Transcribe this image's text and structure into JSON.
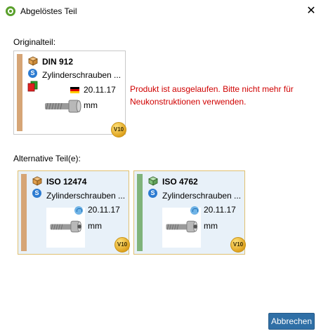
{
  "window": {
    "title": "Abgelöstes Teil",
    "close_glyph": "✕"
  },
  "original_label": "Originalteil:",
  "alternatives_label": "Alternative Teil(e):",
  "original_part": {
    "name": "DIN 912",
    "description": "Zylinderschrauben ...",
    "date": "20.11.17",
    "unit": "mm",
    "version": "V10",
    "stripe_color": "#d6a576",
    "cube_color": "#e0a050",
    "icons": [
      "package-icon",
      "standard-icon",
      "documents-icon",
      "german-flag-icon",
      "version-badge-icon"
    ]
  },
  "message": "Produkt ist ausgelaufen. Bitte nicht mehr für Neukonstruktionen verwenden.",
  "alternatives": [
    {
      "name": "ISO 12474",
      "description": "Zylinderschrauben ...",
      "date": "20.11.17",
      "unit": "mm",
      "version": "V10",
      "stripe_color": "#d6a576",
      "cube_color": "#e0a050"
    },
    {
      "name": "ISO 4762",
      "description": "Zylinderschrauben ...",
      "date": "20.11.17",
      "unit": "mm",
      "version": "V10",
      "stripe_color": "#7fb37a",
      "cube_color": "#7fc07a"
    }
  ],
  "cancel_button": "Abbrechen",
  "colors": {
    "accent": "#2f6fa6",
    "warning_text": "#d00000",
    "alt_card_border": "#e0c070",
    "alt_card_bg": "#e8f1f9"
  }
}
